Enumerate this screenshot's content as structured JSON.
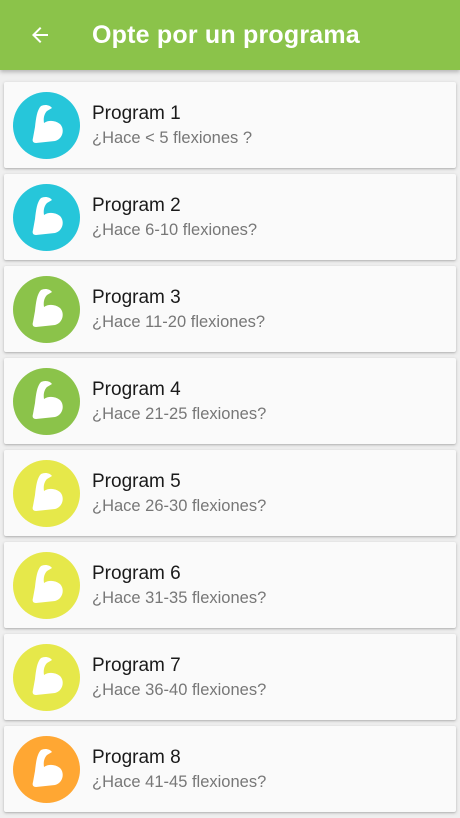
{
  "header": {
    "title": "Opte por un programa",
    "back_icon": "arrow-left-icon",
    "background": "#8bc34a"
  },
  "programs": [
    {
      "title": "Program 1",
      "subtitle": "¿Hace < 5 flexiones ?",
      "color": "#26c6da",
      "icon": "flexed-bicep-icon"
    },
    {
      "title": "Program 2",
      "subtitle": "¿Hace 6-10 flexiones?",
      "color": "#26c6da",
      "icon": "flexed-bicep-icon"
    },
    {
      "title": "Program 3",
      "subtitle": "¿Hace 11-20 flexiones?",
      "color": "#8bc34a",
      "icon": "flexed-bicep-icon"
    },
    {
      "title": "Program 4",
      "subtitle": "¿Hace 21-25 flexiones?",
      "color": "#8bc34a",
      "icon": "flexed-bicep-icon"
    },
    {
      "title": "Program 5",
      "subtitle": "¿Hace 26-30 flexiones?",
      "color": "#e6e84a",
      "icon": "flexed-bicep-icon"
    },
    {
      "title": "Program 6",
      "subtitle": "¿Hace 31-35 flexiones?",
      "color": "#e6e84a",
      "icon": "flexed-bicep-icon"
    },
    {
      "title": "Program 7",
      "subtitle": "¿Hace 36-40 flexiones?",
      "color": "#e6e84a",
      "icon": "flexed-bicep-icon"
    },
    {
      "title": "Program 8",
      "subtitle": "¿Hace 41-45 flexiones?",
      "color": "#ffa733",
      "icon": "flexed-bicep-icon"
    }
  ]
}
